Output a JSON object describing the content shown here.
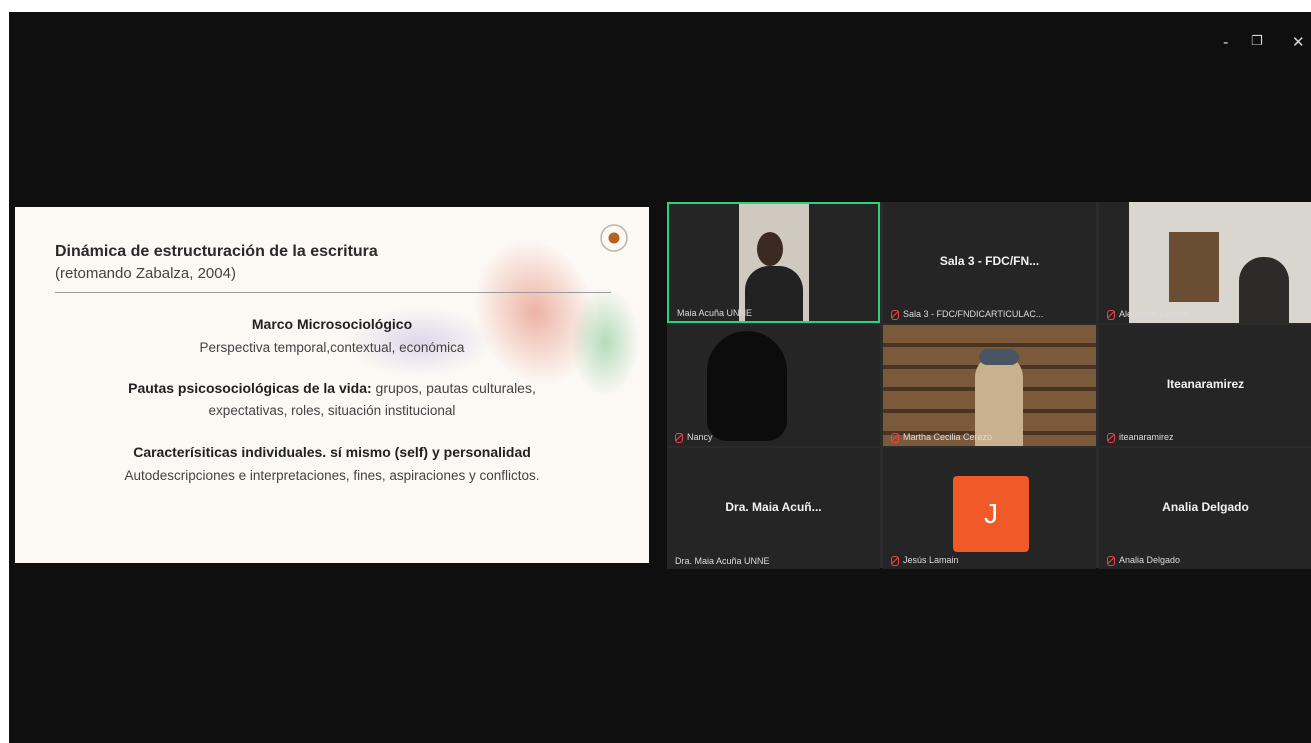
{
  "window": {
    "controls": {
      "minimize": "-",
      "restore": "❐",
      "close": "✕"
    }
  },
  "slide": {
    "title": "Dinámica de estructuración de la escritura",
    "subtitle": "(retomando Zabalza, 2004)",
    "section1": {
      "heading": "Marco Microsociológico",
      "text": "Perspectiva temporal,contextual, económica"
    },
    "section2": {
      "heading": "Pautas psicosociológicas de la vida:",
      "text_inline": " grupos, pautas culturales,",
      "text_line2": "expectativas, roles, situación institucional"
    },
    "section3": {
      "heading": "Caracterísiticas individuales. sí mismo (self) y personalidad",
      "text": "Autodescripciones e interpretaciones, fines, aspiraciones y conflictos."
    }
  },
  "participants": [
    {
      "label": "Maia Acuña UNNE",
      "muted": false,
      "display": "video"
    },
    {
      "label": "Sala 3 - FDC/FNDICARTICULAC...",
      "center": "Sala 3 - FDC/FN...",
      "muted": true,
      "display": "name"
    },
    {
      "label": "Alejandro Lozano",
      "muted": true,
      "display": "video"
    },
    {
      "label": "Nancy",
      "muted": true,
      "display": "video"
    },
    {
      "label": "Martha Cecilia Cerezo",
      "muted": true,
      "display": "video"
    },
    {
      "label": "iteanaramirez",
      "center": "Iteanaramirez",
      "muted": true,
      "display": "name"
    },
    {
      "label": "Dra. Maia Acuña UNNE",
      "center": "Dra. Maia Acuñ...",
      "muted": false,
      "display": "name"
    },
    {
      "label": "Jesús Lamain",
      "avatar_letter": "J",
      "muted": true,
      "display": "avatar"
    },
    {
      "label": "Analia Delgado",
      "center": "Analia Delgado",
      "muted": true,
      "display": "name"
    }
  ],
  "colors": {
    "active_speaker_border": "#2fd27a",
    "avatar_orange": "#f05a28",
    "muted_icon": "#ee4444"
  }
}
